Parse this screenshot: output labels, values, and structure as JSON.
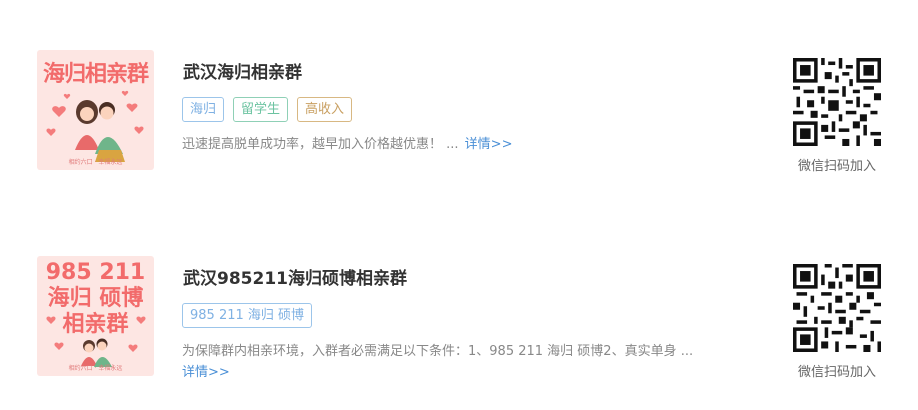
{
  "groups": [
    {
      "poster_title": "海归相亲群",
      "poster_caption": "相约六口 · 幸福永远",
      "title": "武汉海归相亲群",
      "tags": [
        "海归",
        "留学生",
        "高收入"
      ],
      "description": "迅速提高脱单成功率，越早加入价格越优惠！ ...",
      "more_label": "详情>>",
      "qr_label": "微信扫码加入"
    },
    {
      "poster_lines": [
        "985 211",
        "海归 硕博",
        "相亲群"
      ],
      "poster_caption": "相约六口 · 幸福永远",
      "title": "武汉985211海归硕博相亲群",
      "tags": [
        "985 211 海归 硕博"
      ],
      "description": "为保障群内相亲环境，入群者必需满足以下条件：1、985 211 海归 硕博2、真实单身 ...",
      "more_label": "详情>>",
      "qr_label": "微信扫码加入"
    }
  ],
  "colors": {
    "poster_bg": "#fde6e3",
    "poster_text": "#f26b6b",
    "link": "#4a8fd6",
    "tag_blue": "#7fb1e3",
    "tag_green": "#6cc3a1",
    "tag_gold": "#c9a062"
  }
}
